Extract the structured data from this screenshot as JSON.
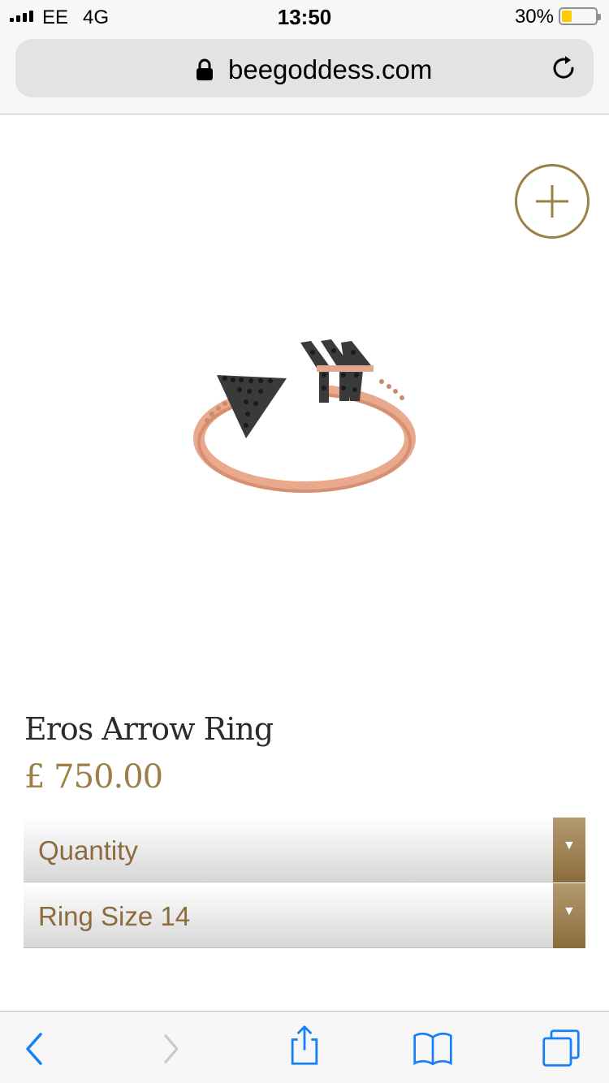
{
  "status_bar": {
    "carrier": "EE",
    "network": "4G",
    "time": "13:50",
    "battery_percent": "30%",
    "battery_level": 0.3,
    "battery_color": "#ffcc00"
  },
  "address_bar": {
    "url": "beegoddess.com",
    "lock_icon": "lock-icon",
    "reload_icon": "reload-icon"
  },
  "product": {
    "zoom_icon": "plus-icon",
    "image_icon": "arrow-ring-image",
    "title": "Eros Arrow Ring",
    "price": "£ 750.00",
    "accent_color": "#9b7f46"
  },
  "options": {
    "quantity_label": "Quantity",
    "ring_size_label": "Ring Size 14",
    "arrow_icon": "triangle-down-icon"
  },
  "toolbar": {
    "icons": [
      "back-icon",
      "forward-icon",
      "share-icon",
      "bookmarks-icon",
      "tabs-icon"
    ],
    "tint_color": "#147efb"
  }
}
